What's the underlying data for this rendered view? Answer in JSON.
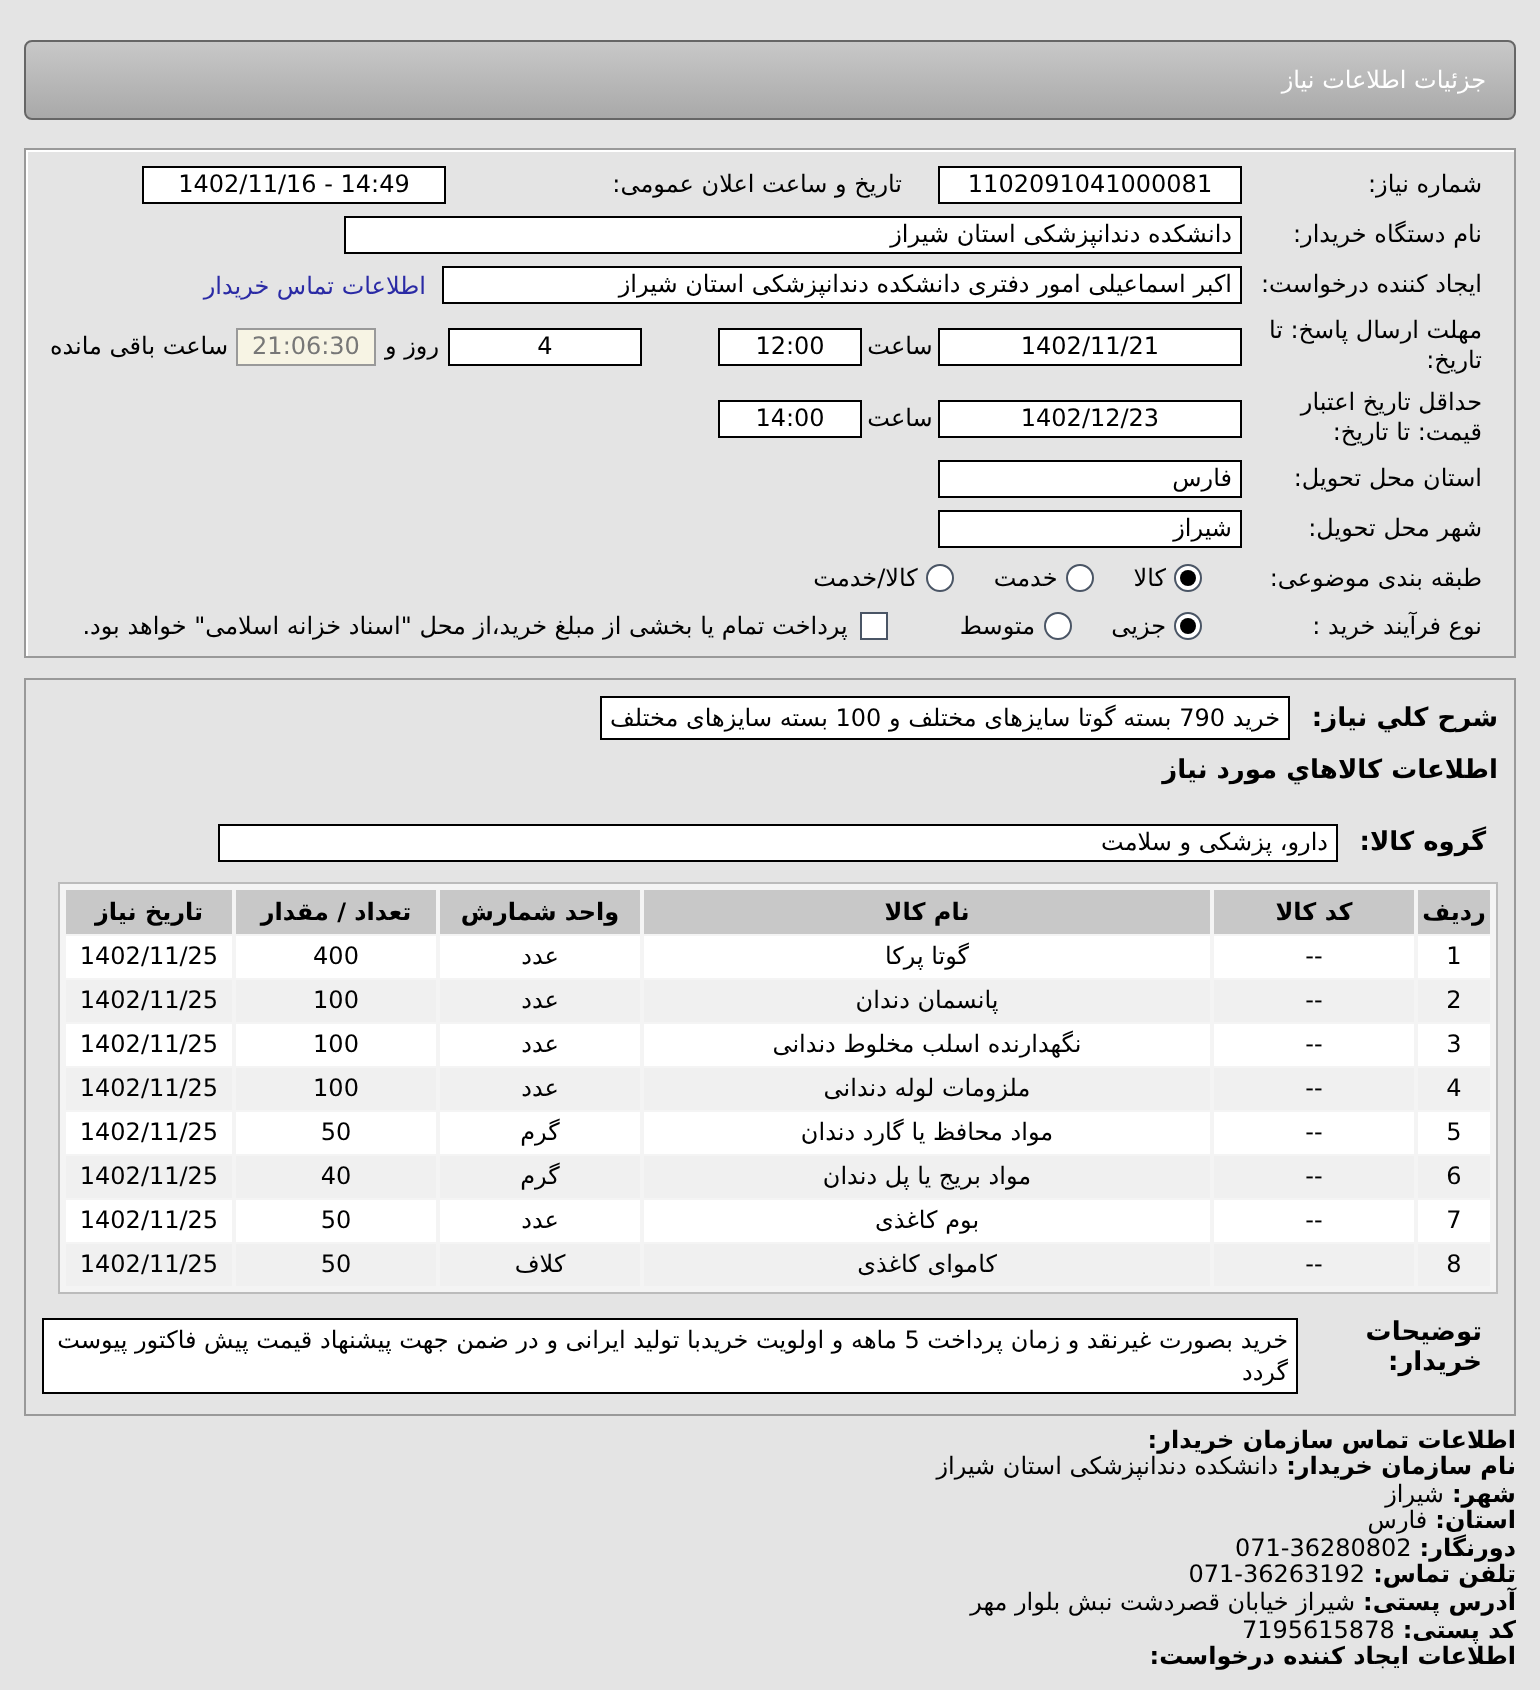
{
  "header": {
    "title": "جزئیات اطلاعات نیاز"
  },
  "need_number": {
    "label": "شماره نیاز:",
    "value": "1102091041000081"
  },
  "announce": {
    "label": "تاریخ و ساعت اعلان عمومی:",
    "value": "1402/11/16 - 14:49"
  },
  "buyer_org": {
    "label": "نام دستگاه خریدار:",
    "value": "دانشکده دندانپزشکی استان شیراز"
  },
  "requester": {
    "label": "ایجاد کننده درخواست:",
    "value": "اکبر  اسماعیلی امور دفتری دانشکده دندانپزشکی استان شیراز",
    "link": "اطلاعات تماس خریدار"
  },
  "deadline": {
    "label": "مهلت ارسال پاسخ: تا تاریخ:",
    "date": "1402/11/21",
    "time_label": "ساعت",
    "time": "12:00",
    "days": "4",
    "days_label": "روز و",
    "remaining": "21:06:30",
    "remaining_label": "ساعت باقی مانده"
  },
  "validity": {
    "label": "حداقل تاریخ اعتبار قیمت: تا تاریخ:",
    "date": "1402/12/23",
    "time_label": "ساعت",
    "time": "14:00"
  },
  "province": {
    "label": "استان محل تحویل:",
    "value": "فارس"
  },
  "city": {
    "label": "شهر محل تحویل:",
    "value": "شیراز"
  },
  "category": {
    "label": "طبقه بندی موضوعی:",
    "options": [
      {
        "label": "کالا",
        "selected": true
      },
      {
        "label": "خدمت",
        "selected": false
      },
      {
        "label": "کالا/خدمت",
        "selected": false
      }
    ]
  },
  "process": {
    "label": "نوع فرآیند خرید :",
    "options": [
      {
        "label": "جزیی",
        "selected": true
      },
      {
        "label": "متوسط",
        "selected": false
      }
    ],
    "payment": {
      "checked": false,
      "label": "پرداخت تمام یا بخشی از مبلغ خرید،از محل \"اسناد خزانه اسلامی\" خواهد بود."
    }
  },
  "description": {
    "label": "شرح کلي نياز:",
    "value": "خرید 790 بسته گوتا سایزهای مختلف و 100 بسته سایزهای مختلف"
  },
  "goods_title": "اطلاعات كالاهاي مورد نياز",
  "group": {
    "label": "گروه کالا:",
    "value": "دارو، پزشکی و سلامت"
  },
  "table": {
    "columns": [
      "ردیف",
      "کد کالا",
      "نام کالا",
      "واحد شمارش",
      "تعداد / مقدار",
      "تاریخ نیاز"
    ],
    "rows": [
      [
        "1",
        "--",
        "گوتا پرکا",
        "عدد",
        "400",
        "1402/11/25"
      ],
      [
        "2",
        "--",
        "پانسمان دندان",
        "عدد",
        "100",
        "1402/11/25"
      ],
      [
        "3",
        "--",
        "نگهدارنده اسلب مخلوط دندانی",
        "عدد",
        "100",
        "1402/11/25"
      ],
      [
        "4",
        "--",
        "ملزومات لوله دندانی",
        "عدد",
        "100",
        "1402/11/25"
      ],
      [
        "5",
        "--",
        "مواد محافظ یا گارد دندان",
        "گرم",
        "50",
        "1402/11/25"
      ],
      [
        "6",
        "--",
        "مواد بریج یا پل دندان",
        "گرم",
        "40",
        "1402/11/25"
      ],
      [
        "7",
        "--",
        "بوم کاغذی",
        "عدد",
        "50",
        "1402/11/25"
      ],
      [
        "8",
        "--",
        "کاموای کاغذی",
        "کلاف",
        "50",
        "1402/11/25"
      ]
    ]
  },
  "buyer_notes": {
    "label": "توضیحات خریدار:",
    "value": "خرید بصورت غیرنقد و زمان پرداخت 5 ماهه و اولویت خریدبا تولید ایرانی و در ضمن جهت پیشنهاد قیمت پیش فاکتور پیوست گردد"
  },
  "contact": {
    "title": "اطلاعات تماس سازمان خریدار:",
    "lines": [
      {
        "label": "نام سازمان خریدار:",
        "value": "دانشکده دندانپزشکی استان شیراز"
      },
      {
        "label": "شهر:",
        "value": "شیراز"
      },
      {
        "label": "استان:",
        "value": "فارس"
      },
      {
        "label": "دورنگار:",
        "value": "071-36280802"
      },
      {
        "label": "تلفن تماس:",
        "value": "071-36263192"
      },
      {
        "label": "آدرس پستی:",
        "value": "شیراز خیابان قصردشت نبش بلوار مهر"
      },
      {
        "label": "کد پستی:",
        "value": "7195615878"
      }
    ],
    "next_title": "اطلاعات ایجاد کننده درخواست:"
  }
}
